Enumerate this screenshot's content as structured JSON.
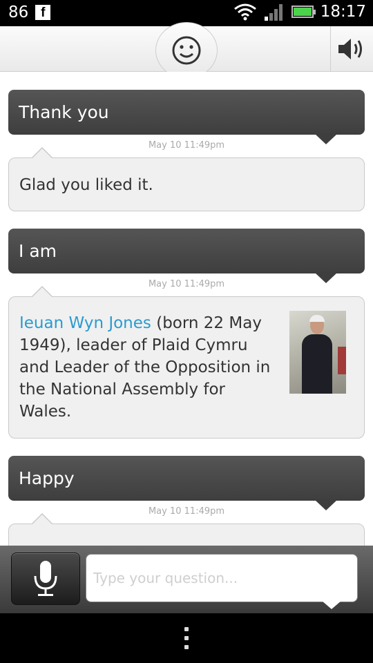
{
  "status_bar": {
    "notification_count": "86",
    "fb_glyph": "f",
    "time": "18:17",
    "icons": [
      "facebook-icon",
      "wifi-icon",
      "signal-icon",
      "battery-icon"
    ]
  },
  "header": {
    "face_icon": "smiley-face-icon",
    "speaker_icon": "speaker-icon"
  },
  "conversation": [
    {
      "user": "Thank you",
      "time": "May 10 11:49pm",
      "reply": "Glad you liked it."
    },
    {
      "user": "I am",
      "time": "May 10 11:49pm",
      "reply_link": "Ieuan Wyn Jones",
      "reply_rest": " (born 22 May 1949), leader of Plaid Cymru and Leader of the Opposition in the National Assembly for Wales."
    },
    {
      "user": "Happy",
      "time": "May 10 11:49pm"
    }
  ],
  "input": {
    "placeholder": "Type your question...",
    "mic_icon": "microphone-icon"
  },
  "nav": {
    "menu_icon": "menu-dots-icon"
  },
  "colors": {
    "link": "#2a9bd0",
    "user_bubble": "#444444",
    "bot_bubble": "#f0f0f0",
    "battery": "#4cd34c"
  }
}
